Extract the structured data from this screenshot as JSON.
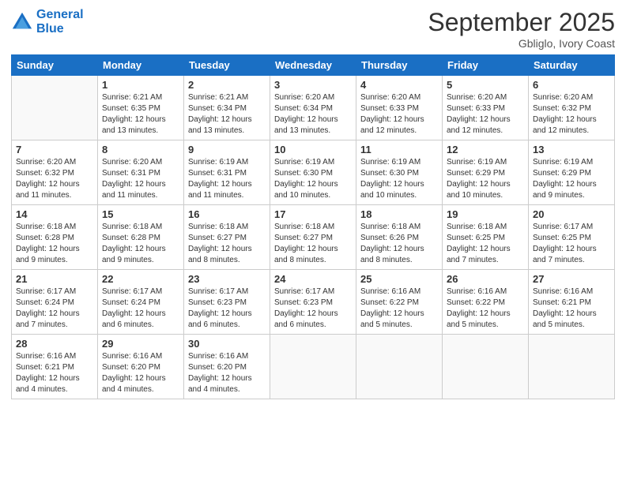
{
  "logo": {
    "line1": "General",
    "line2": "Blue"
  },
  "title": "September 2025",
  "location": "Gbliglo, Ivory Coast",
  "weekdays": [
    "Sunday",
    "Monday",
    "Tuesday",
    "Wednesday",
    "Thursday",
    "Friday",
    "Saturday"
  ],
  "weeks": [
    [
      {
        "day": "",
        "info": ""
      },
      {
        "day": "1",
        "info": "Sunrise: 6:21 AM\nSunset: 6:35 PM\nDaylight: 12 hours\nand 13 minutes."
      },
      {
        "day": "2",
        "info": "Sunrise: 6:21 AM\nSunset: 6:34 PM\nDaylight: 12 hours\nand 13 minutes."
      },
      {
        "day": "3",
        "info": "Sunrise: 6:20 AM\nSunset: 6:34 PM\nDaylight: 12 hours\nand 13 minutes."
      },
      {
        "day": "4",
        "info": "Sunrise: 6:20 AM\nSunset: 6:33 PM\nDaylight: 12 hours\nand 12 minutes."
      },
      {
        "day": "5",
        "info": "Sunrise: 6:20 AM\nSunset: 6:33 PM\nDaylight: 12 hours\nand 12 minutes."
      },
      {
        "day": "6",
        "info": "Sunrise: 6:20 AM\nSunset: 6:32 PM\nDaylight: 12 hours\nand 12 minutes."
      }
    ],
    [
      {
        "day": "7",
        "info": "Sunrise: 6:20 AM\nSunset: 6:32 PM\nDaylight: 12 hours\nand 11 minutes."
      },
      {
        "day": "8",
        "info": "Sunrise: 6:20 AM\nSunset: 6:31 PM\nDaylight: 12 hours\nand 11 minutes."
      },
      {
        "day": "9",
        "info": "Sunrise: 6:19 AM\nSunset: 6:31 PM\nDaylight: 12 hours\nand 11 minutes."
      },
      {
        "day": "10",
        "info": "Sunrise: 6:19 AM\nSunset: 6:30 PM\nDaylight: 12 hours\nand 10 minutes."
      },
      {
        "day": "11",
        "info": "Sunrise: 6:19 AM\nSunset: 6:30 PM\nDaylight: 12 hours\nand 10 minutes."
      },
      {
        "day": "12",
        "info": "Sunrise: 6:19 AM\nSunset: 6:29 PM\nDaylight: 12 hours\nand 10 minutes."
      },
      {
        "day": "13",
        "info": "Sunrise: 6:19 AM\nSunset: 6:29 PM\nDaylight: 12 hours\nand 9 minutes."
      }
    ],
    [
      {
        "day": "14",
        "info": "Sunrise: 6:18 AM\nSunset: 6:28 PM\nDaylight: 12 hours\nand 9 minutes."
      },
      {
        "day": "15",
        "info": "Sunrise: 6:18 AM\nSunset: 6:28 PM\nDaylight: 12 hours\nand 9 minutes."
      },
      {
        "day": "16",
        "info": "Sunrise: 6:18 AM\nSunset: 6:27 PM\nDaylight: 12 hours\nand 8 minutes."
      },
      {
        "day": "17",
        "info": "Sunrise: 6:18 AM\nSunset: 6:27 PM\nDaylight: 12 hours\nand 8 minutes."
      },
      {
        "day": "18",
        "info": "Sunrise: 6:18 AM\nSunset: 6:26 PM\nDaylight: 12 hours\nand 8 minutes."
      },
      {
        "day": "19",
        "info": "Sunrise: 6:18 AM\nSunset: 6:25 PM\nDaylight: 12 hours\nand 7 minutes."
      },
      {
        "day": "20",
        "info": "Sunrise: 6:17 AM\nSunset: 6:25 PM\nDaylight: 12 hours\nand 7 minutes."
      }
    ],
    [
      {
        "day": "21",
        "info": "Sunrise: 6:17 AM\nSunset: 6:24 PM\nDaylight: 12 hours\nand 7 minutes."
      },
      {
        "day": "22",
        "info": "Sunrise: 6:17 AM\nSunset: 6:24 PM\nDaylight: 12 hours\nand 6 minutes."
      },
      {
        "day": "23",
        "info": "Sunrise: 6:17 AM\nSunset: 6:23 PM\nDaylight: 12 hours\nand 6 minutes."
      },
      {
        "day": "24",
        "info": "Sunrise: 6:17 AM\nSunset: 6:23 PM\nDaylight: 12 hours\nand 6 minutes."
      },
      {
        "day": "25",
        "info": "Sunrise: 6:16 AM\nSunset: 6:22 PM\nDaylight: 12 hours\nand 5 minutes."
      },
      {
        "day": "26",
        "info": "Sunrise: 6:16 AM\nSunset: 6:22 PM\nDaylight: 12 hours\nand 5 minutes."
      },
      {
        "day": "27",
        "info": "Sunrise: 6:16 AM\nSunset: 6:21 PM\nDaylight: 12 hours\nand 5 minutes."
      }
    ],
    [
      {
        "day": "28",
        "info": "Sunrise: 6:16 AM\nSunset: 6:21 PM\nDaylight: 12 hours\nand 4 minutes."
      },
      {
        "day": "29",
        "info": "Sunrise: 6:16 AM\nSunset: 6:20 PM\nDaylight: 12 hours\nand 4 minutes."
      },
      {
        "day": "30",
        "info": "Sunrise: 6:16 AM\nSunset: 6:20 PM\nDaylight: 12 hours\nand 4 minutes."
      },
      {
        "day": "",
        "info": ""
      },
      {
        "day": "",
        "info": ""
      },
      {
        "day": "",
        "info": ""
      },
      {
        "day": "",
        "info": ""
      }
    ]
  ]
}
